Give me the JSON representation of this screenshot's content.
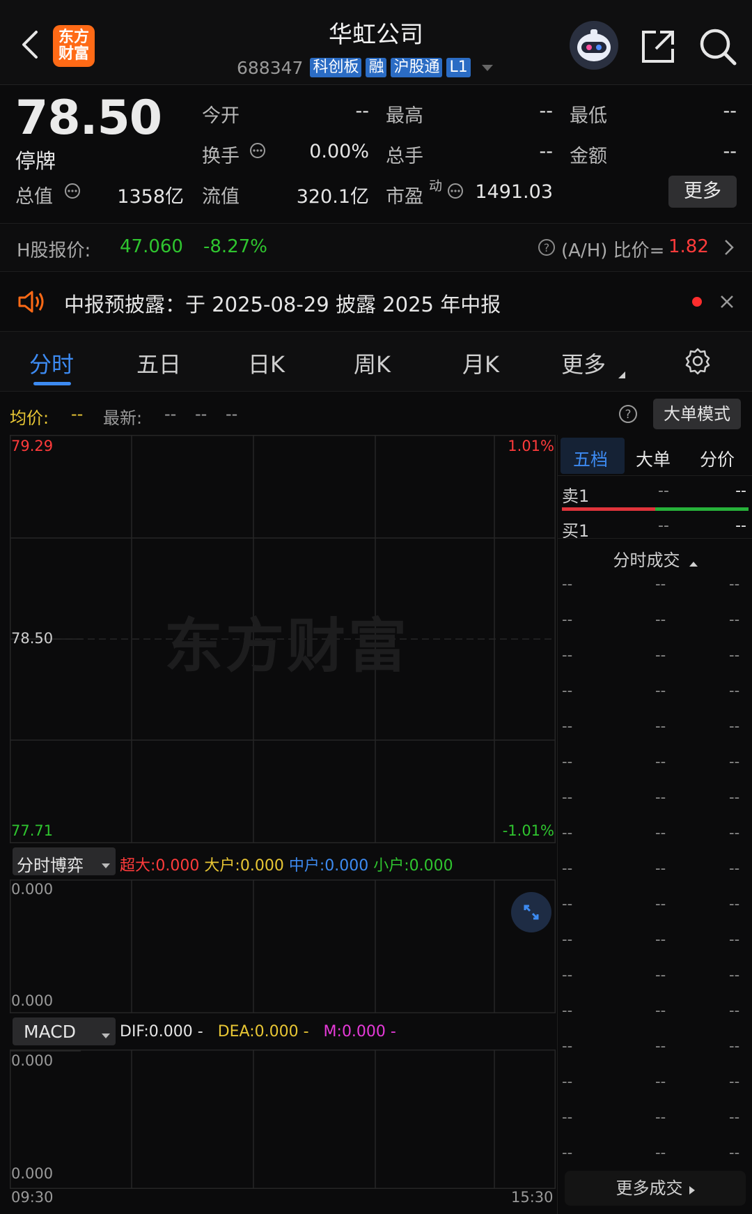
{
  "header": {
    "app_logo_line1": "东方",
    "app_logo_line2": "财富",
    "title": "华虹公司",
    "code": "688347",
    "tags": [
      "科创板",
      "融",
      "沪股通",
      "L1"
    ]
  },
  "quote": {
    "price": "78.50",
    "status": "停牌",
    "open_label": "今开",
    "open_value": "--",
    "high_label": "最高",
    "high_value": "--",
    "low_label": "最低",
    "low_value": "--",
    "turnover_label": "换手",
    "turnover_value": "0.00%",
    "volume_label": "总手",
    "volume_value": "--",
    "amount_label": "金额",
    "amount_value": "--",
    "mktcap_label": "总值",
    "mktcap_value": "1358亿",
    "float_label": "流值",
    "float_value": "320.1亿",
    "pe_label": "市盈",
    "pe_sup": "动",
    "pe_value": "1491.03",
    "more_button": "更多"
  },
  "hshare": {
    "label": "H股报价:",
    "price": "47.060",
    "change": "-8.27%",
    "ah_label": "(A/H) 比价=",
    "ah_value": "1.82"
  },
  "notice": {
    "text": "中报预披露：于 2025-08-29 披露 2025 年中报"
  },
  "chart_tabs": {
    "items": [
      "分时",
      "五日",
      "日K",
      "周K",
      "月K",
      "更多"
    ],
    "active": 0
  },
  "info_bar": {
    "avg_label": "均价:",
    "avg_value": "--",
    "latest_label": "最新:",
    "latest_v1": "--",
    "latest_v2": "--",
    "latest_v3": "--",
    "big_order_button": "大单模式"
  },
  "price_chart": {
    "top_price": "79.29",
    "top_pct": "1.01%",
    "mid_price": "78.50",
    "bottom_price": "77.71",
    "bottom_pct": "-1.01%",
    "watermark": "东方财富"
  },
  "game_panel": {
    "selector": "分时博弈",
    "super_label": "超大:",
    "super_value": "0.000",
    "large_label": "大户:",
    "large_value": "0.000",
    "mid_label": "中户:",
    "mid_value": "0.000",
    "small_label": "小户:",
    "small_value": "0.000",
    "top_value": "0.000",
    "bottom_value": "0.000"
  },
  "macd_panel": {
    "selector": "MACD",
    "dif_label": "DIF:",
    "dif_value": "0.000 -",
    "dea_label": "DEA:",
    "dea_value": "0.000 -",
    "m_label": "M:",
    "m_value": "0.000 -",
    "top_value": "0.000",
    "bottom_value": "0.000"
  },
  "time_axis": {
    "start": "09:30",
    "end": "15:30"
  },
  "order_book": {
    "tabs": [
      "五档",
      "大单",
      "分价"
    ],
    "sell1_label": "卖1",
    "sell1_price": "--",
    "sell1_vol": "--",
    "buy1_label": "买1",
    "buy1_price": "--",
    "buy1_vol": "--",
    "trades_header": "分时成交",
    "trade_placeholder": "--",
    "more_trades": "更多成交"
  },
  "colors": {
    "up": "#ff3b3b",
    "down": "#2fc52f",
    "accent": "#3d8bf2",
    "yellow": "#e8c634",
    "magenta": "#e63ad8",
    "bg": "#0b0b0c"
  }
}
